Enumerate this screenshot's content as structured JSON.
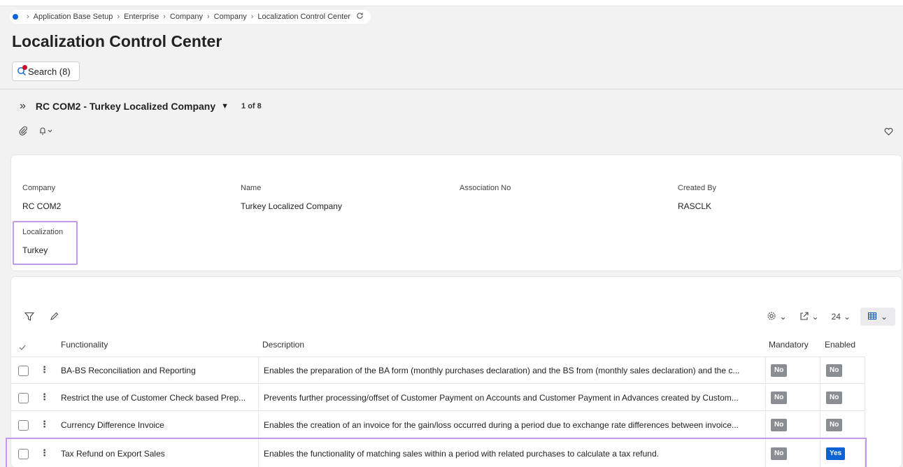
{
  "breadcrumb": {
    "items": [
      "Application Base Setup",
      "Enterprise",
      "Company",
      "Company",
      "Localization Control Center"
    ]
  },
  "page": {
    "title": "Localization Control Center"
  },
  "search": {
    "label": "Search (8)"
  },
  "record": {
    "title": "RC COM2 - Turkey Localized Company",
    "count": "1 of 8"
  },
  "fields": {
    "company_label": "Company",
    "company_value": "RC COM2",
    "name_label": "Name",
    "name_value": "Turkey Localized Company",
    "association_label": "Association No",
    "association_value": "",
    "created_by_label": "Created By",
    "created_by_value": "RASCLK",
    "localization_label": "Localization",
    "localization_value": "Turkey"
  },
  "grid": {
    "page_size": "24",
    "columns": [
      "Functionality",
      "Description",
      "Mandatory",
      "Enabled"
    ],
    "rows": [
      {
        "functionality": "BA-BS Reconciliation and Reporting",
        "description": "Enables the preparation of the BA form (monthly purchases declaration) and the BS from (monthly sales declaration) and the c...",
        "mandatory": "No",
        "enabled": "No"
      },
      {
        "functionality": "Restrict the use of Customer Check based Prep...",
        "description": "Prevents further processing/offset of Customer Payment on Accounts and Customer Payment in Advances created by Custom...",
        "mandatory": "No",
        "enabled": "No"
      },
      {
        "functionality": "Currency Difference Invoice",
        "description": "Enables the creation of an invoice for the gain/loss occurred during a period due to exchange rate differences between invoice...",
        "mandatory": "No",
        "enabled": "No"
      },
      {
        "functionality": "Tax Refund on Export Sales",
        "description": "Enables the functionality of matching sales within a period with related purchases to calculate a tax refund.",
        "mandatory": "No",
        "enabled": "Yes"
      }
    ]
  },
  "icons": {
    "home": "home-dot-icon",
    "refresh": "refresh-icon",
    "search": "search-icon",
    "expand": "double-chevron-right-icon",
    "record_caret": "caret-down-icon",
    "attach": "paperclip-icon",
    "bell": "bell-icon",
    "heart": "heart-icon",
    "filter": "filter-icon",
    "edit": "pencil-icon",
    "settings": "gear-icon",
    "export": "export-icon",
    "view": "table-view-icon"
  },
  "colors": {
    "accent": "#0b63d6",
    "highlight": "#c39ae6",
    "badge_no": "#8a8d91",
    "badge_yes": "#0b63d6",
    "search_dot": "#c8102e"
  }
}
